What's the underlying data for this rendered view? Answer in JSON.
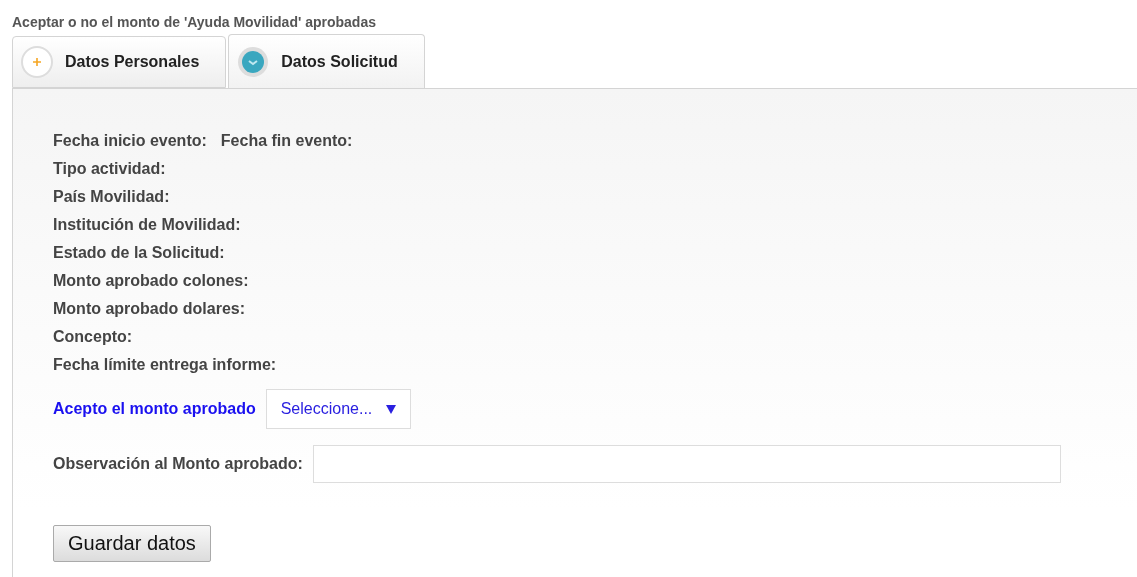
{
  "title": "Aceptar o no el monto de 'Ayuda Movilidad' aprobadas",
  "tabs": [
    {
      "label": "Datos Personales",
      "selected": false
    },
    {
      "label": "Datos Solicitud",
      "selected": true
    }
  ],
  "field_rows": [
    [
      "Fecha inicio evento:",
      "Fecha fin evento:"
    ],
    [
      "Tipo actividad:"
    ],
    [
      "País Movilidad:"
    ],
    [
      "Institución de Movilidad:"
    ],
    [
      "Estado de la Solicitud:"
    ],
    [
      "Monto aprobado colones:"
    ],
    [
      "Monto aprobado dolares:"
    ],
    [
      "Concepto:"
    ],
    [
      "Fecha límite entrega informe:"
    ]
  ],
  "accept": {
    "label": "Acepto el monto aprobado",
    "value": "Seleccione..."
  },
  "observation": {
    "label": "Observación al Monto aprobado:"
  },
  "save_button": "Guardar datos"
}
